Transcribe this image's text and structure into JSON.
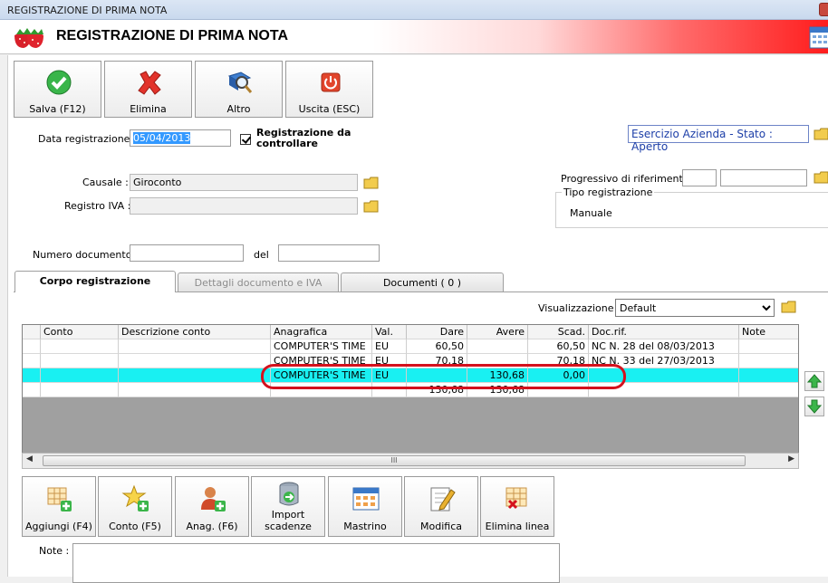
{
  "window": {
    "title": "REGISTRAZIONE DI PRIMA NOTA"
  },
  "header": {
    "title": "REGISTRAZIONE DI PRIMA NOTA"
  },
  "toolbar": {
    "save": "Salva (F12)",
    "delete": "Elimina",
    "other": "Altro",
    "exit": "Uscita (ESC)"
  },
  "form": {
    "data_registrazione_label": "Data registrazione :",
    "data_registrazione": "05/04/2013",
    "registrazione_da_controllare_label": "Registrazione da controllare",
    "esercizio": "Esercizio Azienda - Stato : Aperto",
    "causale_label": "Causale :",
    "causale": "Giroconto",
    "registro_iva_label": "Registro IVA :",
    "registro_iva": "",
    "progressivo_label": "Progressivo di riferimento :",
    "progressivo_1": "",
    "progressivo_2": "",
    "tipo_registrazione_label": "Tipo registrazione",
    "tipo_registrazione": "Manuale",
    "numero_documento_label": "Numero documento :",
    "numero_documento": "",
    "del_label": "del",
    "del_value": ""
  },
  "tabs": [
    {
      "label": "Corpo registrazione",
      "active": true
    },
    {
      "label": "Dettagli documento e IVA",
      "disabled": true
    },
    {
      "label": "Documenti ( 0 )"
    }
  ],
  "visualizzazione": {
    "label": "Visualizzazione :",
    "selected": "Default"
  },
  "grid": {
    "columns": [
      "Conto",
      "Descrizione conto",
      "Anagrafica",
      "Val.",
      "Dare",
      "Avere",
      "Scad.",
      "Doc.rif.",
      "Note"
    ],
    "rows": [
      [
        "",
        "",
        "COMPUTER'S TIME",
        "EU",
        "60,50",
        "",
        "60,50",
        "NC N. 28 del 08/03/2013",
        ""
      ],
      [
        "",
        "",
        "COMPUTER'S TIME",
        "EU",
        "70,18",
        "",
        "70,18",
        "NC N. 33 del 27/03/2013",
        ""
      ],
      [
        "",
        "",
        "COMPUTER'S TIME",
        "EU",
        "",
        "130,68",
        "0,00",
        "",
        ""
      ]
    ],
    "totals": {
      "dare": "130,68",
      "avere": "130,68"
    },
    "scroll_glyph": "III"
  },
  "bottom_buttons": {
    "aggiungi": "Aggiungi (F4)",
    "conto": "Conto (F5)",
    "anag": "Anag. (F6)",
    "import_1": "Import",
    "import_2": "scadenze",
    "mastrino": "Mastrino",
    "modifica": "Modifica",
    "elimina_linea": "Elimina linea"
  },
  "note_label": "Note :",
  "colors": {
    "selected_row": "#19f0f2",
    "highlight": "#d4111d",
    "header_red": "#ff1d1d"
  }
}
